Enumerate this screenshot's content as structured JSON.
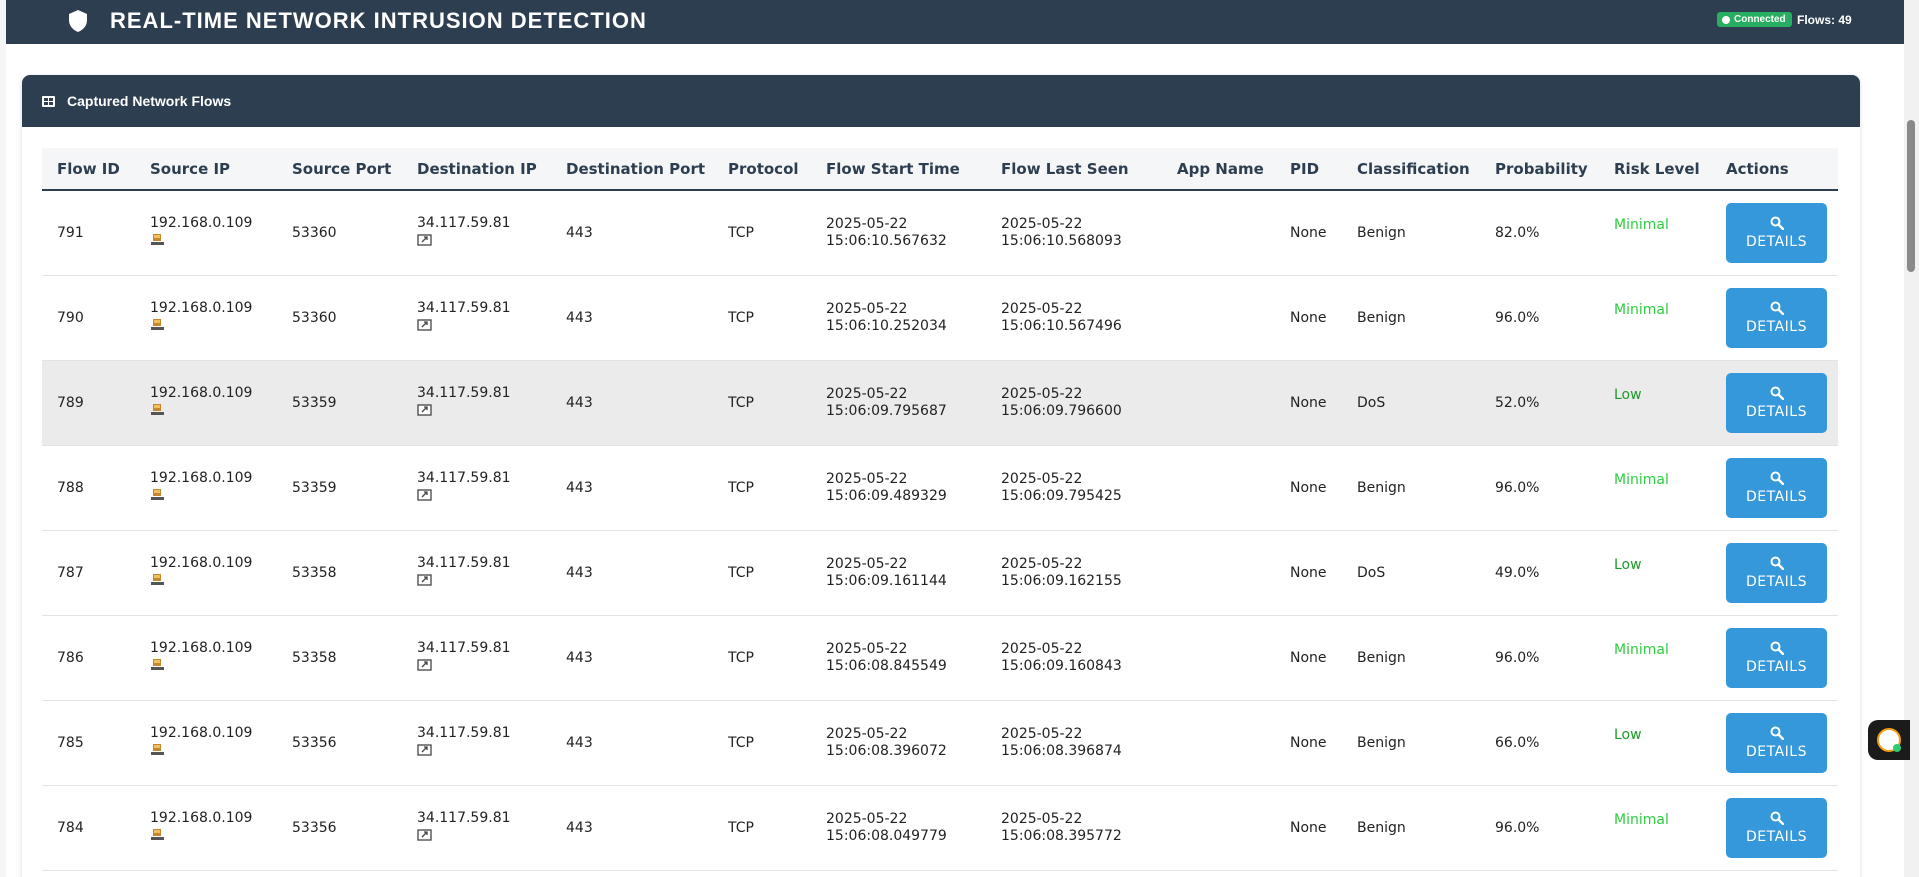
{
  "header": {
    "title": "REAL-TIME NETWORK INTRUSION DETECTION",
    "icon": "shield-icon",
    "status": "Connected",
    "flows": "Flows: 49"
  },
  "card": {
    "title": "Captured Network Flows",
    "icon": "table-icon"
  },
  "table": {
    "columns": [
      "Flow ID",
      "Source IP",
      "Source Port",
      "Destination IP",
      "Destination Port",
      "Protocol",
      "Flow Start Time",
      "Flow Last Seen",
      "App Name",
      "PID",
      "Classification",
      "Probability",
      "Risk Level",
      "Actions"
    ],
    "button_label": "DETAILS",
    "rows": [
      {
        "id": "791",
        "src_ip": "192.168.0.109",
        "src_port": "53360",
        "dst_ip": "34.117.59.81",
        "dst_port": "443",
        "protocol": "TCP",
        "start_date": "2025-05-22",
        "start_time": "15:06:10.567632",
        "last_date": "2025-05-22",
        "last_time": "15:06:10.568093",
        "app": "",
        "pid": "None",
        "classification": "Benign",
        "probability": "82.0%",
        "risk": "Minimal"
      },
      {
        "id": "790",
        "src_ip": "192.168.0.109",
        "src_port": "53360",
        "dst_ip": "34.117.59.81",
        "dst_port": "443",
        "protocol": "TCP",
        "start_date": "2025-05-22",
        "start_time": "15:06:10.252034",
        "last_date": "2025-05-22",
        "last_time": "15:06:10.567496",
        "app": "",
        "pid": "None",
        "classification": "Benign",
        "probability": "96.0%",
        "risk": "Minimal"
      },
      {
        "id": "789",
        "src_ip": "192.168.0.109",
        "src_port": "53359",
        "dst_ip": "34.117.59.81",
        "dst_port": "443",
        "protocol": "TCP",
        "start_date": "2025-05-22",
        "start_time": "15:06:09.795687",
        "last_date": "2025-05-22",
        "last_time": "15:06:09.796600",
        "app": "",
        "pid": "None",
        "classification": "DoS",
        "probability": "52.0%",
        "risk": "Low"
      },
      {
        "id": "788",
        "src_ip": "192.168.0.109",
        "src_port": "53359",
        "dst_ip": "34.117.59.81",
        "dst_port": "443",
        "protocol": "TCP",
        "start_date": "2025-05-22",
        "start_time": "15:06:09.489329",
        "last_date": "2025-05-22",
        "last_time": "15:06:09.795425",
        "app": "",
        "pid": "None",
        "classification": "Benign",
        "probability": "96.0%",
        "risk": "Minimal"
      },
      {
        "id": "787",
        "src_ip": "192.168.0.109",
        "src_port": "53358",
        "dst_ip": "34.117.59.81",
        "dst_port": "443",
        "protocol": "TCP",
        "start_date": "2025-05-22",
        "start_time": "15:06:09.161144",
        "last_date": "2025-05-22",
        "last_time": "15:06:09.162155",
        "app": "",
        "pid": "None",
        "classification": "DoS",
        "probability": "49.0%",
        "risk": "Low"
      },
      {
        "id": "786",
        "src_ip": "192.168.0.109",
        "src_port": "53358",
        "dst_ip": "34.117.59.81",
        "dst_port": "443",
        "protocol": "TCP",
        "start_date": "2025-05-22",
        "start_time": "15:06:08.845549",
        "last_date": "2025-05-22",
        "last_time": "15:06:09.160843",
        "app": "",
        "pid": "None",
        "classification": "Benign",
        "probability": "96.0%",
        "risk": "Minimal"
      },
      {
        "id": "785",
        "src_ip": "192.168.0.109",
        "src_port": "53356",
        "dst_ip": "34.117.59.81",
        "dst_port": "443",
        "protocol": "TCP",
        "start_date": "2025-05-22",
        "start_time": "15:06:08.396072",
        "last_date": "2025-05-22",
        "last_time": "15:06:08.396874",
        "app": "",
        "pid": "None",
        "classification": "Benign",
        "probability": "66.0%",
        "risk": "Low"
      },
      {
        "id": "784",
        "src_ip": "192.168.0.109",
        "src_port": "53356",
        "dst_ip": "34.117.59.81",
        "dst_port": "443",
        "protocol": "TCP",
        "start_date": "2025-05-22",
        "start_time": "15:06:08.049779",
        "last_date": "2025-05-22",
        "last_time": "15:06:08.395772",
        "app": "",
        "pid": "None",
        "classification": "Benign",
        "probability": "96.0%",
        "risk": "Minimal"
      }
    ]
  },
  "colors": {
    "header_bg": "#2c3e50",
    "status_green": "#27ae60",
    "button_blue": "#3498db",
    "risk_minimal": "#2ecc40",
    "risk_low": "#1e9a2a"
  }
}
